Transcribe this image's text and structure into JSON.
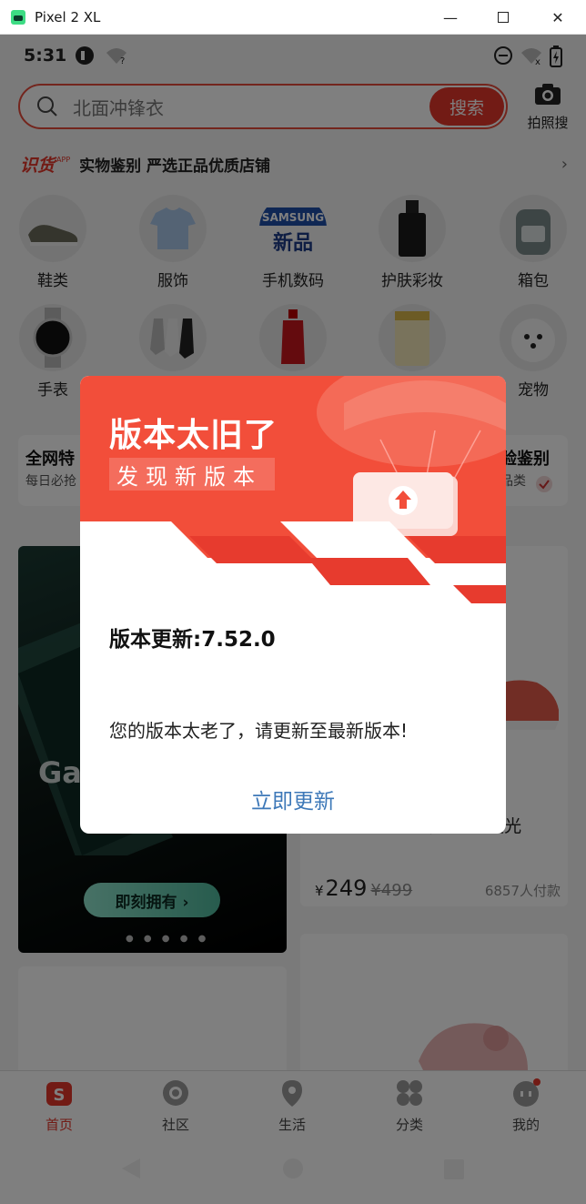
{
  "window": {
    "title": "Pixel 2 XL",
    "minimize": "—",
    "close": "✕"
  },
  "statusbar": {
    "time": "5:31"
  },
  "search": {
    "placeholder": "北面冲锋衣",
    "button": "搜索",
    "camera_label": "拍照搜"
  },
  "banner": {
    "logo": "识货",
    "logo_sup": "APP",
    "tagline": "实物鉴别 严选正品优质店铺",
    "chevron": "›"
  },
  "categories_row1": [
    {
      "label": "鞋类",
      "icon": "sneaker-icon"
    },
    {
      "label": "服饰",
      "icon": "tshirt-icon"
    },
    {
      "label": "手机数码",
      "icon": "samsung-new-icon"
    },
    {
      "label": "护肤彩妆",
      "icon": "perfume-icon"
    },
    {
      "label": "箱包",
      "icon": "backpack-icon"
    }
  ],
  "categories_row2": [
    {
      "label": "手表",
      "icon": "watch-icon"
    },
    {
      "label": "",
      "icon": "socks-icon"
    },
    {
      "label": "",
      "icon": "cola-icon"
    },
    {
      "label": "",
      "icon": "milk-powder-icon"
    },
    {
      "label": "宠物",
      "icon": "dog-icon"
    }
  ],
  "samsung_badge": {
    "brand": "SAMSUNG",
    "text": "新品"
  },
  "promos": {
    "left_title": "全网特",
    "left_sub": "每日必抢",
    "right_title": "验鉴别",
    "right_sub": "品类"
  },
  "feed": {
    "ad_text": "Ga",
    "ad_cta": "即刻拥有 ›",
    "ad_dots": "● ● ● ● ●",
    "product_text": "抗扭转 防滑耐磨 跑鞋 荧光",
    "price_symbol": "¥",
    "price": "249",
    "original_price": "¥499",
    "paid_count": "6857人付款"
  },
  "bottom_nav": [
    {
      "label": "首页",
      "icon": "home-icon",
      "active": true
    },
    {
      "label": "社区",
      "icon": "community-icon",
      "active": false
    },
    {
      "label": "生活",
      "icon": "location-icon",
      "active": false
    },
    {
      "label": "分类",
      "icon": "category-icon",
      "active": false
    },
    {
      "label": "我的",
      "icon": "profile-icon",
      "active": false
    }
  ],
  "dialog": {
    "title": "版本太旧了",
    "subtitle": "发现新版本",
    "version": "版本更新:7.52.0",
    "message": "您的版本太老了，请更新至最新版本!",
    "button": "立即更新"
  },
  "colors": {
    "accent": "#e4362a",
    "dialog_red": "#f24e3a",
    "link_blue": "#3d78b8"
  }
}
